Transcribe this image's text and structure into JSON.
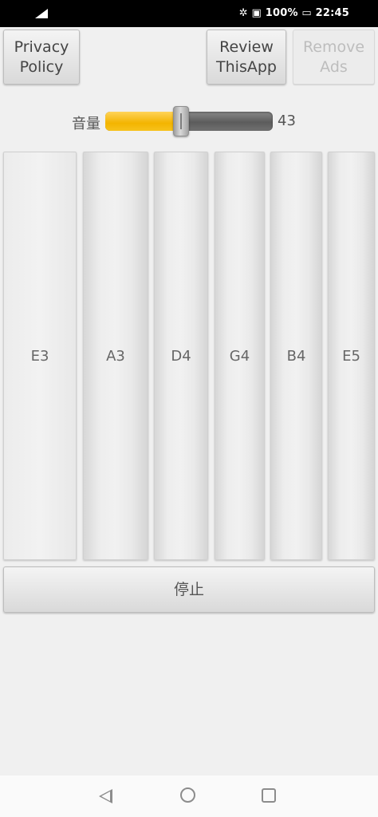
{
  "status_bar": {
    "right_text": "✲ ▣ 100% ▭ 22:45"
  },
  "header": {
    "privacy_label": "Privacy\nPolicy",
    "review_label": "Review\nThisApp",
    "remove_ads_label": "Remove\nAds"
  },
  "volume": {
    "label": "音量",
    "value": "43",
    "level": 43,
    "max": 100
  },
  "strings": [
    {
      "note": "E3"
    },
    {
      "note": "A3"
    },
    {
      "note": "D4"
    },
    {
      "note": "G4"
    },
    {
      "note": "B4"
    },
    {
      "note": "E5"
    }
  ],
  "stop": {
    "label": "停止"
  },
  "colors": {
    "accent": "#f3b400",
    "background": "#f0f0f0"
  },
  "icons": {
    "nav_back": "back-triangle-icon",
    "nav_home": "home-circle-icon",
    "nav_recent": "recent-square-icon"
  }
}
